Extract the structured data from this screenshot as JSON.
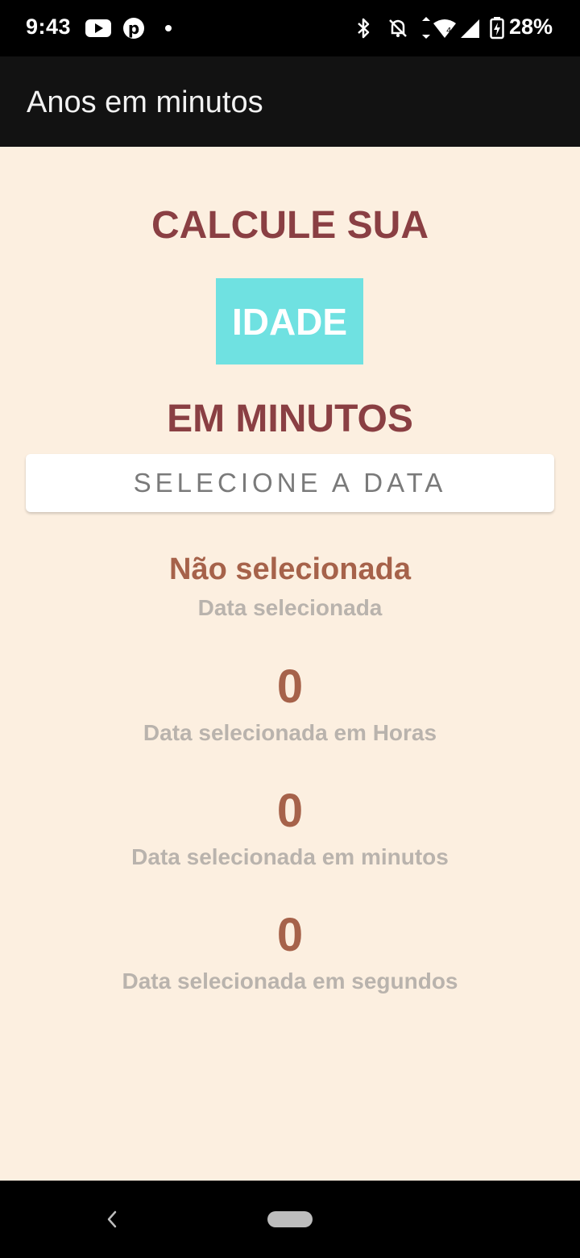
{
  "status_bar": {
    "time": "9:43",
    "battery": "28%",
    "icons": [
      "youtube-icon",
      "pinterest-icon",
      "dot-icon",
      "bluetooth-icon",
      "mute-icon",
      "wifi-icon",
      "signal-icon",
      "battery-icon"
    ]
  },
  "app_bar": {
    "title": "Anos em minutos"
  },
  "header": {
    "line1": "CALCULE SUA",
    "highlight": "IDADE",
    "line3": "EM MINUTOS",
    "highlight_bg": "#6fe1e1",
    "heading_color": "#8a3f43"
  },
  "select_button": {
    "label": "SELECIONE A DATA"
  },
  "results": {
    "date_value": "Não selecionada",
    "date_caption": "Data selecionada",
    "hours_value": "0",
    "hours_caption": "Data selecionada em Horas",
    "minutes_value": "0",
    "minutes_caption": "Data selecionada em minutos",
    "seconds_value": "0",
    "seconds_caption": "Data selecionada em segundos",
    "value_color": "#a6624a",
    "caption_color": "#b9b3ad"
  },
  "colors": {
    "background": "#fcefe0",
    "app_bar": "#121212"
  },
  "nav_bar": {
    "icons": [
      "back-icon",
      "home-pill-icon"
    ]
  }
}
